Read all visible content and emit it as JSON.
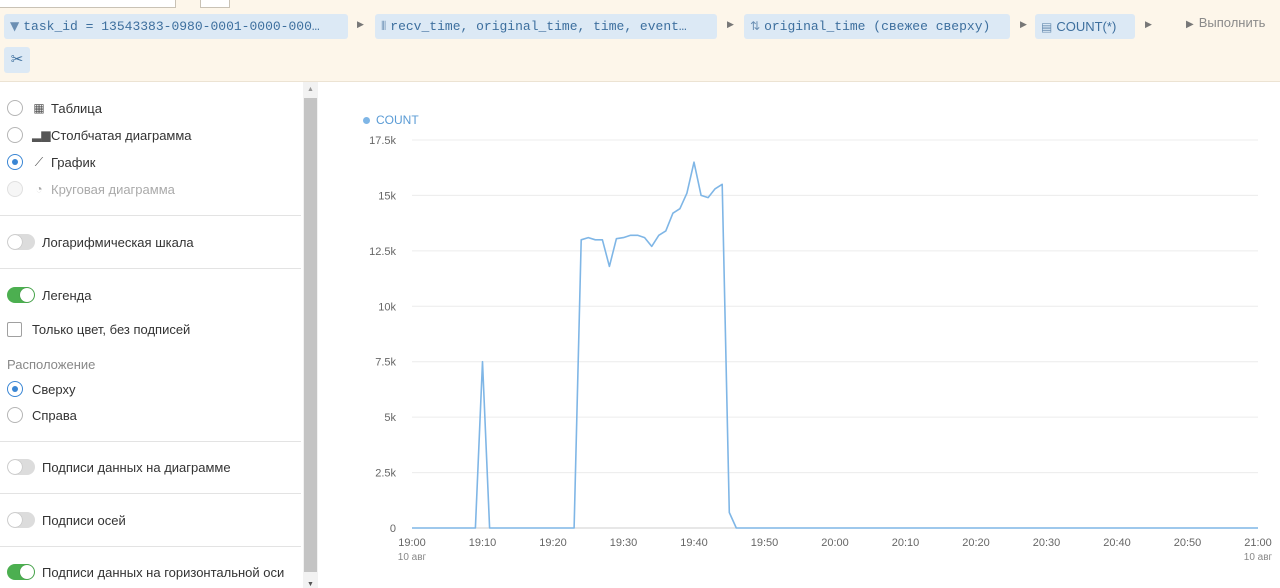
{
  "toolbar": {
    "filter_chip": "task_id = 13543383-0980-0001-0000-000…",
    "columns_chip": "recv_time, original_time, time, event…",
    "sort_chip": "original_time (свежее сверху)",
    "aggregate_chip": "COUNT(*)",
    "run_label": "Выполнить"
  },
  "panel": {
    "chart_types": [
      {
        "label": "Таблица",
        "icon": "table-icon",
        "selected": false,
        "disabled": false
      },
      {
        "label": "Столбчатая диаграмма",
        "icon": "bar-chart-icon",
        "selected": false,
        "disabled": false
      },
      {
        "label": "График",
        "icon": "line-chart-icon",
        "selected": true,
        "disabled": false
      },
      {
        "label": "Круговая диаграмма",
        "icon": "pie-chart-icon",
        "selected": false,
        "disabled": true
      }
    ],
    "log_scale_label": "Логарифмическая шкала",
    "legend_label": "Легенда",
    "color_only_label": "Только цвет, без подписей",
    "position_heading": "Расположение",
    "position_top": "Сверху",
    "position_right": "Справа",
    "data_labels_label": "Подписи данных на диаграмме",
    "axis_labels_label": "Подписи осей",
    "horizontal_labels_label": "Подписи данных на горизонтальной оси"
  },
  "chart_data": {
    "type": "line",
    "series": [
      {
        "name": "COUNT",
        "color": "#7fb6e6",
        "x": [
          "19:00",
          "19:01",
          "19:02",
          "19:03",
          "19:04",
          "19:05",
          "19:06",
          "19:07",
          "19:08",
          "19:09",
          "19:10",
          "19:11",
          "19:12",
          "19:13",
          "19:14",
          "19:15",
          "19:16",
          "19:17",
          "19:18",
          "19:19",
          "19:20",
          "19:21",
          "19:22",
          "19:23",
          "19:24",
          "19:25",
          "19:26",
          "19:27",
          "19:28",
          "19:29",
          "19:30",
          "19:31",
          "19:32",
          "19:33",
          "19:34",
          "19:35",
          "19:36",
          "19:37",
          "19:38",
          "19:39",
          "19:40",
          "19:41",
          "19:42",
          "19:43",
          "19:44",
          "19:45",
          "19:46",
          "19:47",
          "19:48",
          "19:49",
          "19:50",
          "20:00",
          "20:10",
          "20:20",
          "20:30",
          "20:40",
          "20:50",
          "21:00"
        ],
        "values": [
          0,
          0,
          0,
          0,
          0,
          0,
          0,
          0,
          0,
          0,
          7500,
          0,
          0,
          0,
          0,
          0,
          0,
          0,
          0,
          0,
          0,
          0,
          0,
          0,
          13000,
          13100,
          13000,
          13000,
          11800,
          13050,
          13100,
          13200,
          13200,
          13100,
          12700,
          13200,
          13400,
          14200,
          14400,
          15100,
          16500,
          15000,
          14900,
          15300,
          15500,
          700,
          0,
          0,
          0,
          0,
          0,
          0,
          0,
          0,
          0,
          0,
          0,
          0
        ]
      }
    ],
    "x_ticks": [
      "19:00",
      "19:10",
      "19:20",
      "19:30",
      "19:40",
      "19:50",
      "20:00",
      "20:10",
      "20:20",
      "20:30",
      "20:40",
      "20:50",
      "21:00"
    ],
    "x_tick_sublabel": "10 авг",
    "y_ticks": [
      "0",
      "2.5k",
      "5k",
      "7.5k",
      "10k",
      "12.5k",
      "15k",
      "17.5k"
    ],
    "ylim": [
      0,
      17500
    ],
    "legend": "top-left",
    "grid": true
  }
}
